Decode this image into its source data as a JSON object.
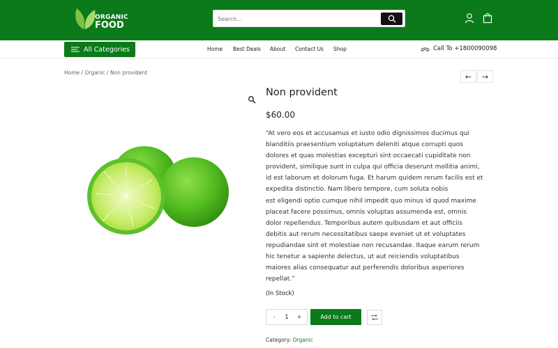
{
  "brand": {
    "logo_line1": "ORGANIC",
    "logo_line2": "FOOD",
    "primary_color": "#0b7a1a"
  },
  "search": {
    "placeholder": "Search...",
    "icon": "search-icon"
  },
  "header_icons": [
    "user-icon",
    "shopping-bag-icon"
  ],
  "nav": {
    "all_categories": "All Categories",
    "menu": [
      "Home",
      "Best Deals",
      "About",
      "Contact Us",
      "Shop"
    ],
    "phone": "Call To +1800090098"
  },
  "breadcrumb": {
    "home": "Home",
    "sep": "/",
    "category": "Organic",
    "current": "Non provident"
  },
  "pager": {
    "prev": "←",
    "next": "→"
  },
  "product": {
    "title": "Non provident",
    "price": "$60.00",
    "description": "“At vero eos et accusamus et iusto odio dignissimos ducimus qui\nblanditiis praesentium voluptatum deleniti atque corrupti quos\ndolores et quas molestias excepturi sint occaecati cupiditate non\nprovident, similique sunt in culpa qui officia deserunt mollitia animi,\nid est laborum et dolorum fuga. Et harum quidem rerum facilis est et\nexpedita distinctio. Nam libero tempore, cum soluta nobis\nest eligendi optio cumque nihil impedit quo minus id quod maxime\nplaceat facere possimus, omnis voluptas assumenda est, omnis\ndolor repellendus. Temporibus autem quibusdam et aut officiis\ndebitis aut rerum necessitatibus saepe eveniet ut et voluptates\nrepudiandae sint et molestiae non recusandae. Itaque earum rerum\nhic tenetur a sapiente delectus, ut aut reiciendis voluptatibus\nmaiores alias consequatur aut perferendis doloribus asperiores\nrepellat.”",
    "stock": "(In Stock)",
    "quantity": {
      "minus": "-",
      "value": "1",
      "plus": "+"
    },
    "add_to_cart": "Add to cart",
    "category_label": "Category:",
    "category_value": "Organic"
  }
}
